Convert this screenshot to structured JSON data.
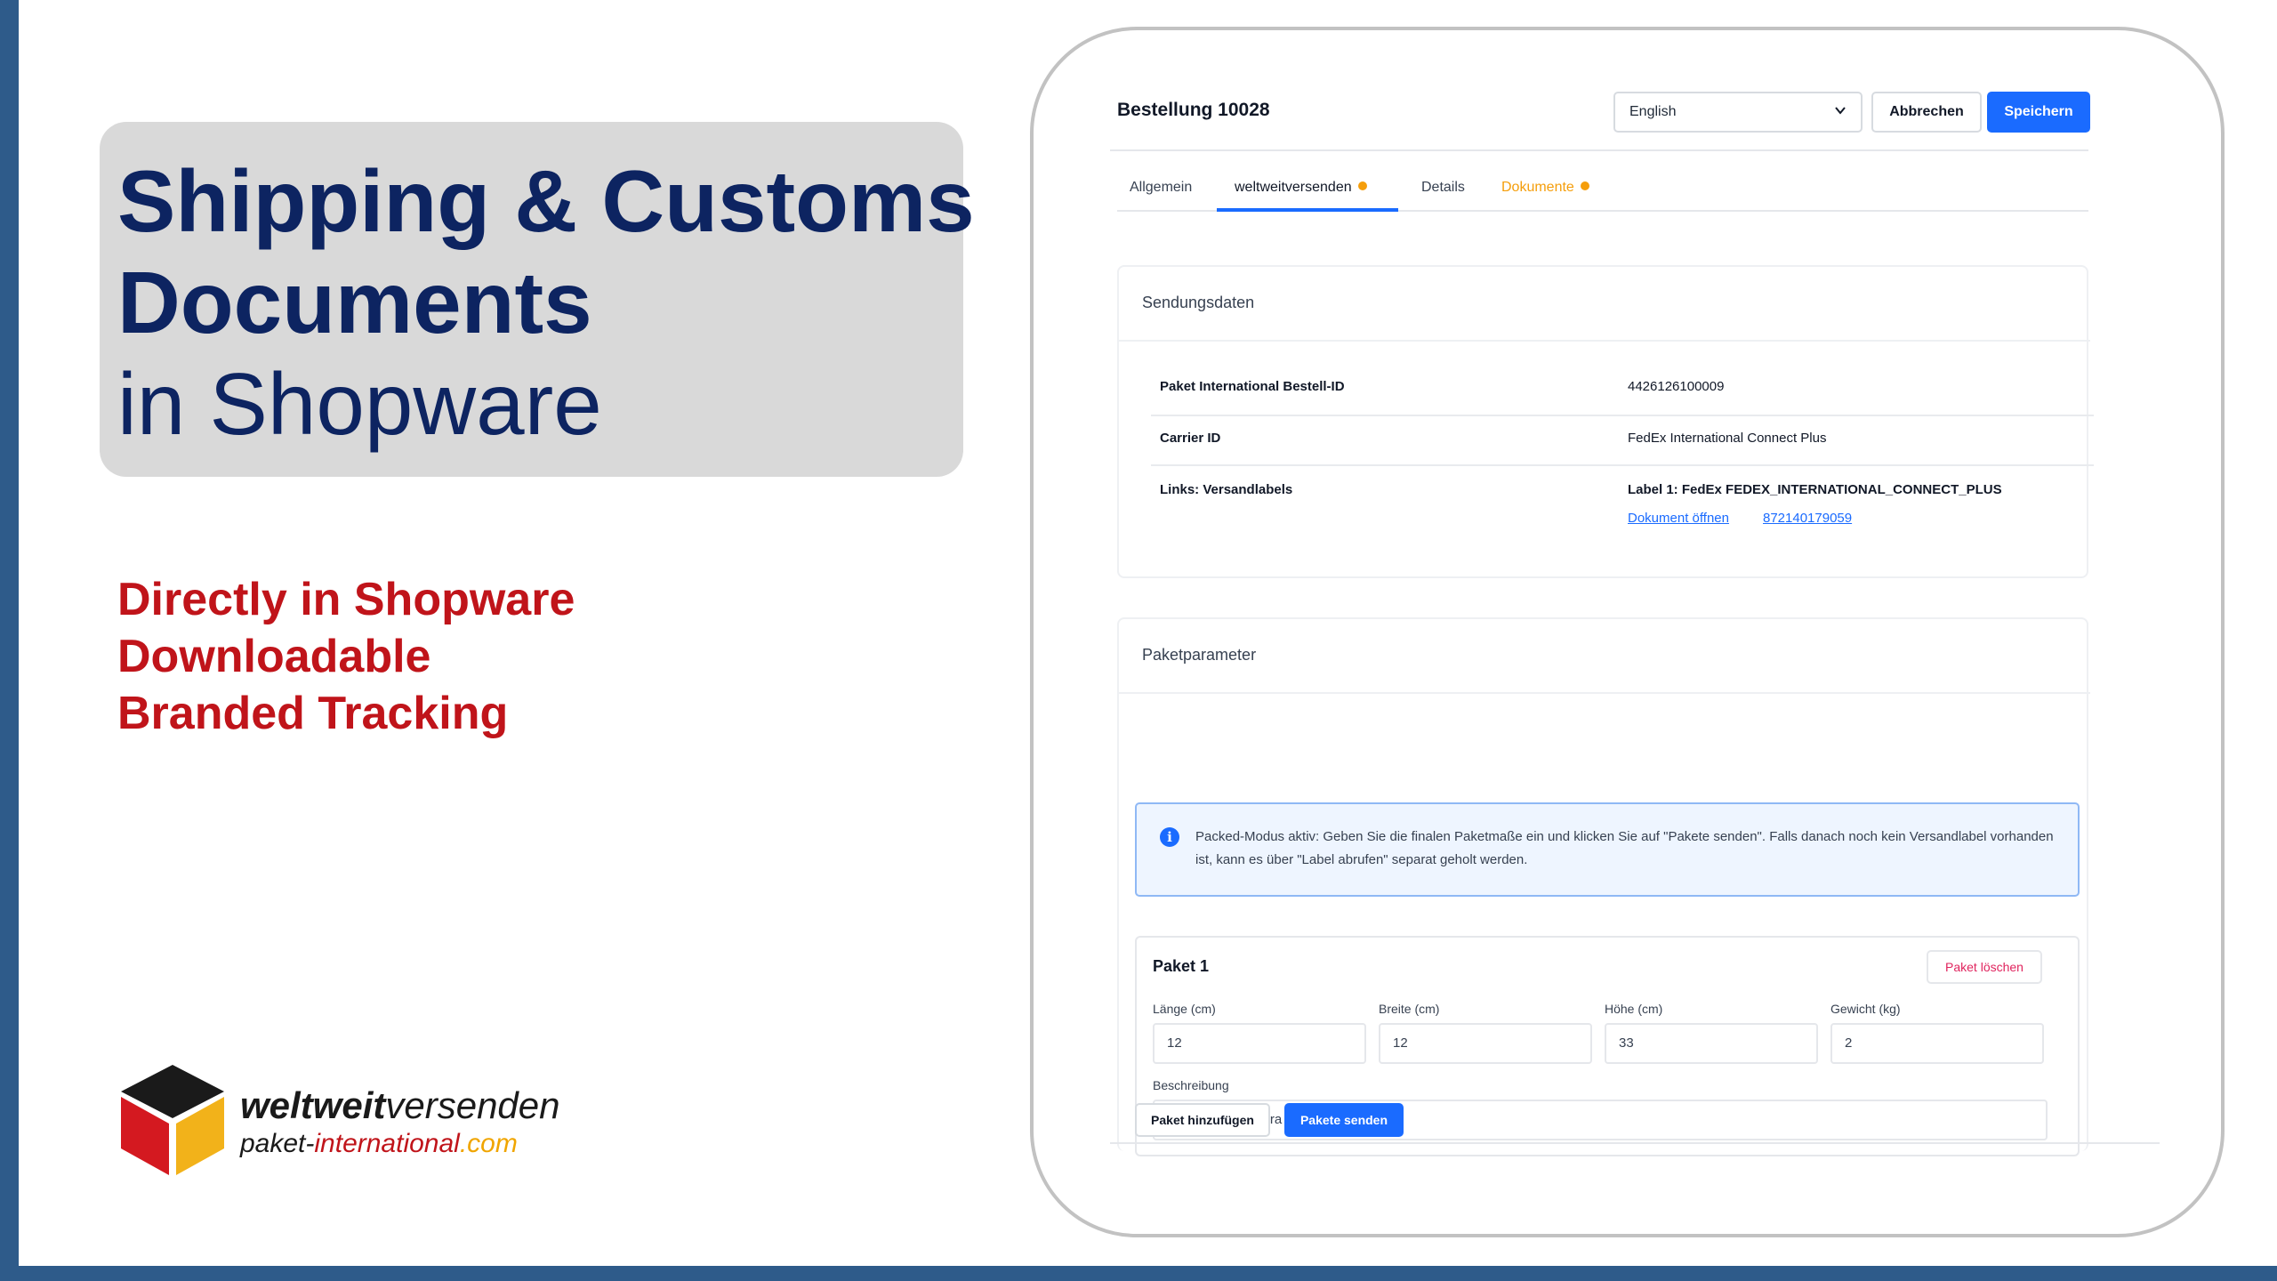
{
  "slide": {
    "title_line1": "Shipping & Customs",
    "title_line2": "Documents",
    "title_line3": "in Shopware",
    "features": [
      "Directly in Shopware",
      "Downloadable",
      "Branded Tracking"
    ],
    "brand": {
      "name_bold": "weltweit",
      "name_regular": "versenden",
      "domain_part1": "paket-",
      "domain_part2": "international",
      "domain_part3": ".com"
    },
    "colors": {
      "frame": "#2e5b8a",
      "title": "#0d2461",
      "features": "#c0141a",
      "title_box": "#d9d9d9"
    }
  },
  "app": {
    "order_title": "Bestellung 10028",
    "language_select": {
      "value": "English",
      "icon": "chevron-down-icon"
    },
    "cancel_label": "Abbrechen",
    "save_label": "Speichern",
    "accent_color": "#1a6bff",
    "tabs": [
      {
        "label": "Allgemein",
        "active": false,
        "badge": false
      },
      {
        "label": "weltweitversenden",
        "active": true,
        "badge": true
      },
      {
        "label": "Details",
        "active": false,
        "badge": false
      },
      {
        "label": "Dokumente",
        "active": false,
        "badge": true
      }
    ],
    "shipment": {
      "title": "Sendungsdaten",
      "rows": [
        {
          "label": "Paket International Bestell-ID",
          "value": "4426126100009"
        },
        {
          "label": "Carrier ID",
          "value": "FedEx International Connect Plus"
        },
        {
          "label": "Links: Versandlabels",
          "value": "Label 1: FedEx FEDEX_INTERNATIONAL_CONNECT_PLUS"
        }
      ],
      "links": [
        "Dokument öffnen",
        "872140179059"
      ]
    },
    "packages": {
      "title": "Paketparameter",
      "info_text": "Packed-Modus aktiv: Geben Sie die finalen Paketmaße ein und klicken Sie auf \"Pakete senden\". Falls danach noch kein Versandlabel vorhanden ist, kann es über \"Label abrufen\" separat geholt werden.",
      "package": {
        "title": "Paket 1",
        "delete_label": "Paket löschen",
        "fields": [
          {
            "label": "Länge (cm)",
            "value": "12"
          },
          {
            "label": "Breite (cm)",
            "value": "12"
          },
          {
            "label": "Höhe (cm)",
            "value": "33"
          },
          {
            "label": "Gewicht (kg)",
            "value": "2"
          }
        ],
        "description_label": "Beschreibung",
        "description_value": "Original WMF Ikora Bauhaus Art Déco"
      },
      "add_label": "Paket hinzufügen",
      "send_label": "Pakete senden"
    }
  }
}
